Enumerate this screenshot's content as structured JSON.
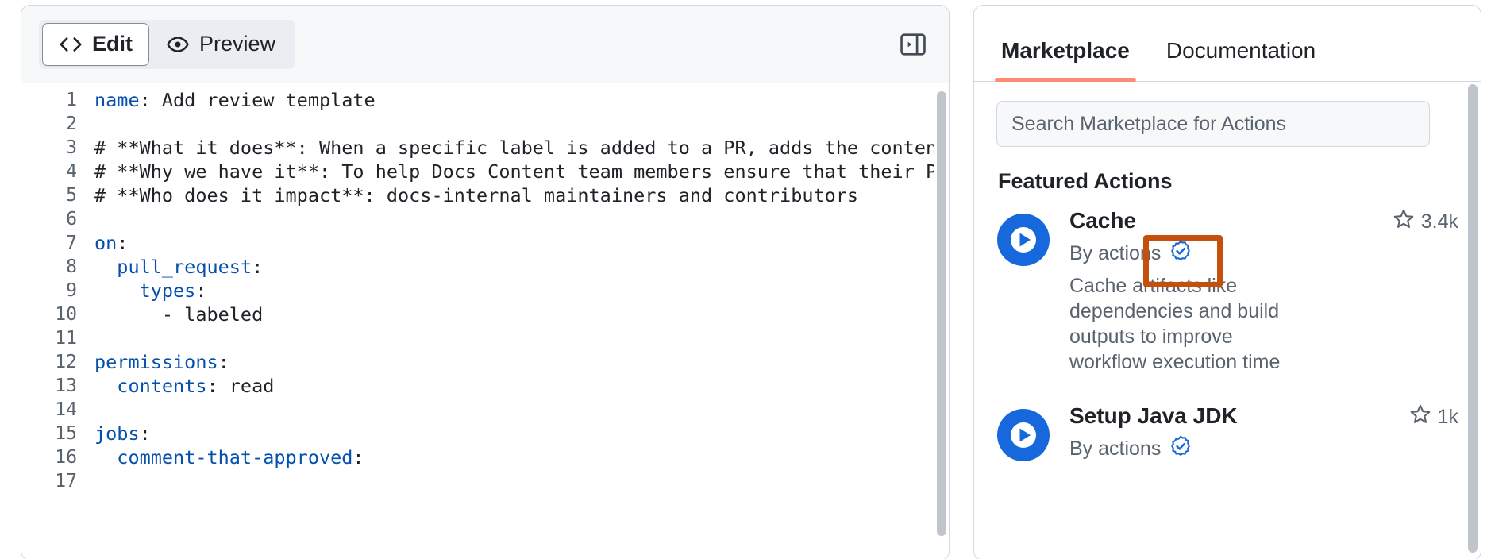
{
  "editor": {
    "tabs": [
      {
        "label": "Edit",
        "icon": "file-code-icon",
        "active": true
      },
      {
        "label": "Preview",
        "icon": "eye-icon",
        "active": false
      }
    ],
    "sidebar_toggle_icon": "panel-collapse-icon",
    "lines": [
      {
        "num": "1",
        "key": "name",
        "rest": ": Add review template"
      },
      {
        "num": "2",
        "key": "",
        "rest": ""
      },
      {
        "num": "3",
        "key": "",
        "rest": "# **What it does**: When a specific label is added to a PR, adds the contents o"
      },
      {
        "num": "4",
        "key": "",
        "rest": "# **Why we have it**: To help Docs Content team members ensure that their PR is"
      },
      {
        "num": "5",
        "key": "",
        "rest": "# **Who does it impact**: docs-internal maintainers and contributors"
      },
      {
        "num": "6",
        "key": "",
        "rest": ""
      },
      {
        "num": "7",
        "key": "on",
        "rest": ":"
      },
      {
        "num": "8",
        "key": "  pull_request",
        "rest": ":"
      },
      {
        "num": "9",
        "key": "    types",
        "rest": ":"
      },
      {
        "num": "10",
        "key": "",
        "rest": "      - labeled"
      },
      {
        "num": "11",
        "key": "",
        "rest": ""
      },
      {
        "num": "12",
        "key": "permissions",
        "rest": ":"
      },
      {
        "num": "13",
        "key": "  contents",
        "rest": ": read"
      },
      {
        "num": "14",
        "key": "",
        "rest": ""
      },
      {
        "num": "15",
        "key": "jobs",
        "rest": ":"
      },
      {
        "num": "16",
        "key": "  comment-that-approved",
        "rest": ":"
      },
      {
        "num": "17",
        "key": "",
        "rest": ""
      }
    ]
  },
  "marketplace": {
    "tabs": [
      {
        "label": "Marketplace",
        "active": true
      },
      {
        "label": "Documentation",
        "active": false
      }
    ],
    "search": {
      "value": "",
      "placeholder": "Search Marketplace for Actions"
    },
    "section_title": "Featured Actions",
    "actions": [
      {
        "name": "Cache",
        "by": "By actions",
        "verified": true,
        "verified_icon": "verified-badge-icon",
        "stars": "3.4k",
        "star_icon": "star-icon",
        "description": "Cache artifacts like dependencies and build outputs to improve workflow execution time",
        "avatar_icon": "play-circle-icon"
      },
      {
        "name": "Setup Java JDK",
        "by": "By actions",
        "verified": true,
        "verified_icon": "verified-badge-icon",
        "stars": "1k",
        "star_icon": "star-icon",
        "description": "",
        "avatar_icon": "play-circle-icon"
      }
    ]
  },
  "annotation": {
    "color": "#c4500b",
    "target": "verified-badge-icon"
  }
}
